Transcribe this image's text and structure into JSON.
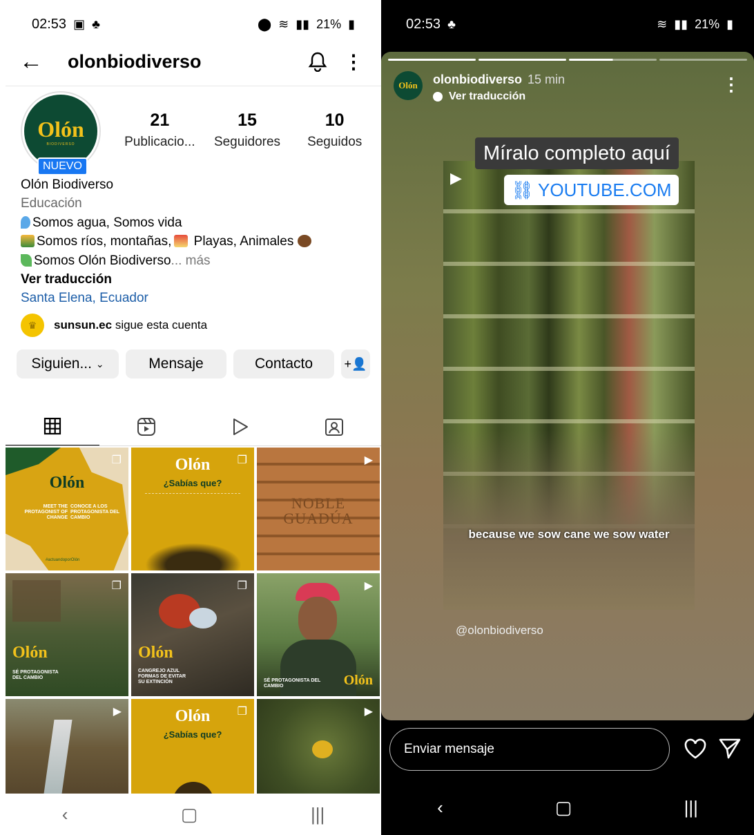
{
  "left": {
    "status": {
      "time": "02:53",
      "battery": "21%"
    },
    "header": {
      "username": "olonbiodiverso"
    },
    "avatar": {
      "logo_text": "Olón",
      "logo_sub": "BIODIVERSO",
      "badge": "NUEVO"
    },
    "stats": [
      {
        "value": "21",
        "label": "Publicacio..."
      },
      {
        "value": "15",
        "label": "Seguidores"
      },
      {
        "value": "10",
        "label": "Seguidos"
      }
    ],
    "bio": {
      "name": "Olón Biodiverso",
      "category": "Educación",
      "line1": "Somos agua, Somos vida",
      "line2": "Somos ríos, montañas,",
      "line2b": "Playas, Animales",
      "line3": "Somos Olón Biodiverso",
      "more": "... más",
      "translate": "Ver traducción",
      "location": "Santa Elena, Ecuador"
    },
    "followed_by": {
      "user": "sunsun.ec",
      "text": "sigue esta cuenta"
    },
    "buttons": {
      "following": "Siguien...",
      "message": "Mensaje",
      "contact": "Contacto"
    },
    "grid": {
      "post1": {
        "logo": "Olón",
        "left": "MEET THE PROTAGONIST OF CHANGE",
        "right": "CONOCE A LOS PROTAGONISTA DEL CAMBIO",
        "tag": "#actuandoporOlón"
      },
      "post2": {
        "logo": "Olón",
        "title": "¿Sabías que?"
      },
      "post3": {
        "title1": "NOBLE",
        "title2": "GUADÚA"
      },
      "post4": {
        "logo": "Olón",
        "caption": "SÉ PROTAGONISTA DEL CAMBIO"
      },
      "post5": {
        "logo": "Olón",
        "caption": "CANGREJO AZUL FORMAS DE EVITAR SU EXTINCIÓN"
      },
      "post6": {
        "logo": "Olón",
        "caption": "SÉ PROTAGONISTA DEL CAMBIO"
      },
      "post8": {
        "logo": "Olón",
        "title": "¿Sabías que?"
      }
    }
  },
  "right": {
    "status": {
      "time": "02:53",
      "battery": "21%"
    },
    "story": {
      "username": "olonbiodiverso",
      "time": "15 min",
      "translate": "Ver traducción",
      "avatar_logo": "Olón",
      "caption": "Míralo completo aquí",
      "link": "YOUTUBE.COM",
      "subtitle": "because we sow cane we sow water",
      "handle": "@olonbiodiverso"
    },
    "reply_placeholder": "Enviar mensaje"
  }
}
